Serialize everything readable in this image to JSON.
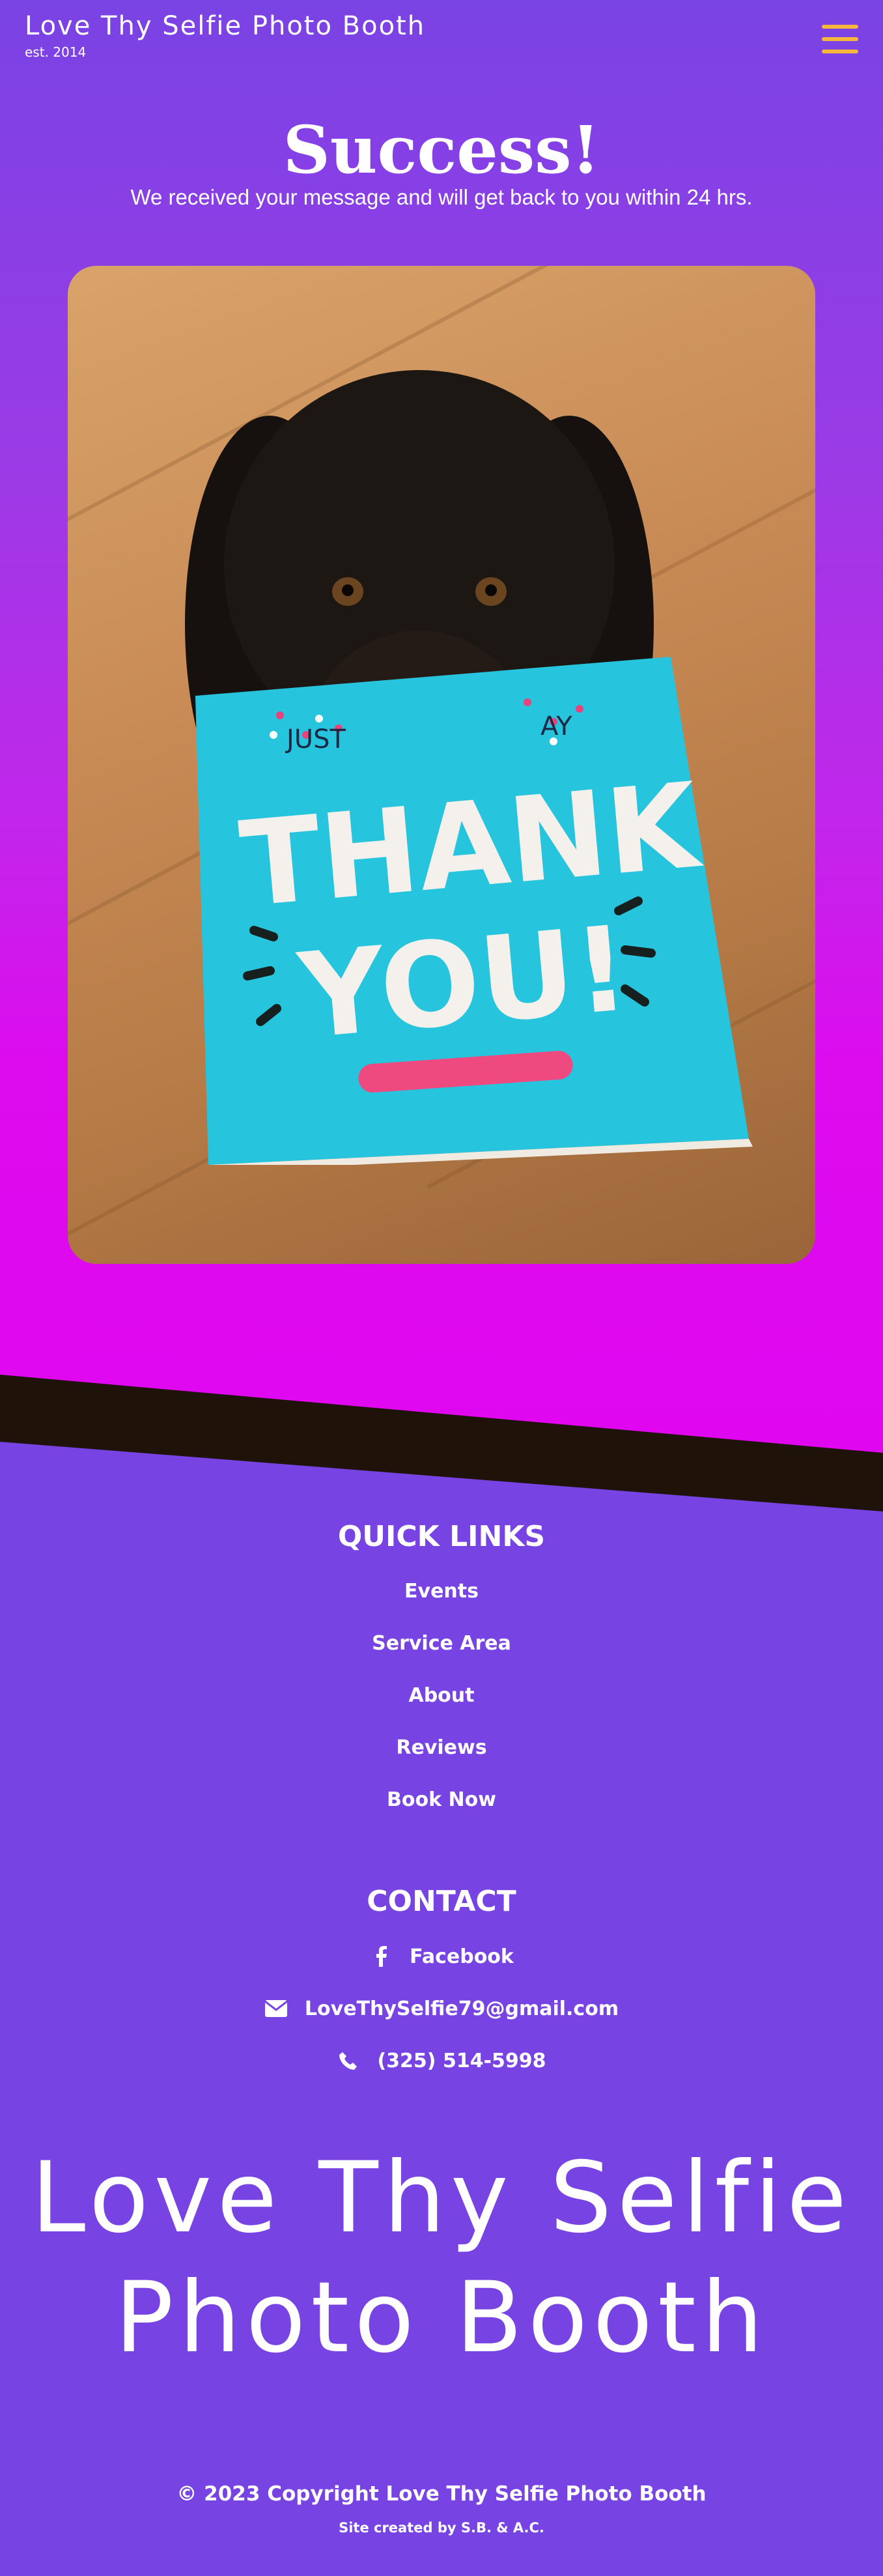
{
  "header": {
    "brand_name": "Love Thy Selfie Photo Booth",
    "brand_est": "est. 2014",
    "menu_icon": "hamburger-menu-icon",
    "menu_color": "#f6b73a"
  },
  "hero": {
    "title": "Success!",
    "subtitle": "We received your message and will get back to you within 24 hrs.",
    "card_text_top": "JUST",
    "card_text_end": "AY",
    "card_text_main_1": "THANK",
    "card_text_main_2": "YOU!"
  },
  "quick_links": {
    "title": "QUICK LINKS",
    "items": [
      "Events",
      "Service Area",
      "About",
      "Reviews",
      "Book Now"
    ]
  },
  "contact": {
    "title": "CONTACT",
    "facebook": "Facebook",
    "email": "LoveThySelfie79@gmail.com",
    "phone": "(325) 514-5998"
  },
  "footer": {
    "logo_line1": "Love Thy Selfie",
    "logo_line2": "Photo Booth",
    "copyright": "© 2023 Copyright Love Thy Selfie Photo Booth",
    "credit": "Site created by S.B. & A.C."
  },
  "colors": {
    "primary": "#7743e3",
    "gradient_end": "#e106f0",
    "accent": "#f6b73a"
  }
}
